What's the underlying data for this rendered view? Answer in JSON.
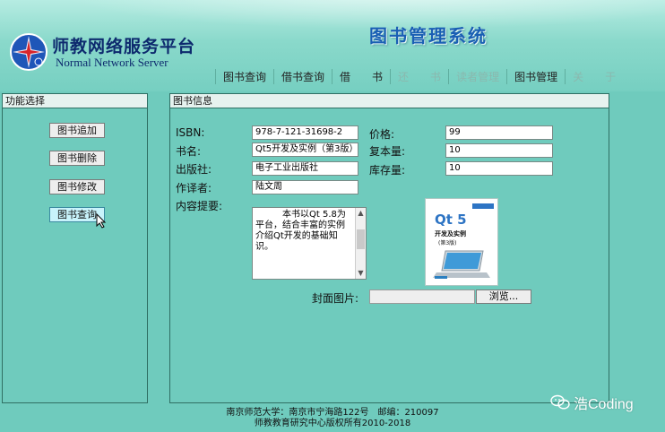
{
  "header": {
    "org_cn": "师教网络服务平台",
    "org_en": "Normal Network Server",
    "system_title": "图书管理系统",
    "nav": [
      {
        "label": "图书查询",
        "state": "normal"
      },
      {
        "label": "借书查询",
        "state": "normal"
      },
      {
        "label": "借　　书",
        "state": "normal"
      },
      {
        "label": "还　　书",
        "state": "dim"
      },
      {
        "label": "读者管理",
        "state": "dim"
      },
      {
        "label": "图书管理",
        "state": "normal"
      },
      {
        "label": "关　　于",
        "state": "dim"
      }
    ]
  },
  "left_panel": {
    "title": "功能选择",
    "buttons": [
      "图书追加",
      "图书删除",
      "图书修改",
      "图书查询"
    ],
    "active_index": 3
  },
  "book_info": {
    "title": "图书信息",
    "isbn_label": "ISBN:",
    "isbn": "978-7-121-31698-2",
    "name_label": "书名:",
    "name": "Qt5开发及实例（第3版）",
    "publisher_label": "出版社:",
    "publisher": "电子工业出版社",
    "author_label": "作译者:",
    "author": "陆文周",
    "summary_label": "内容提要:",
    "summary": "　　　本书以Qt 5.8为平台，结合丰富的实例介绍Qt开发的基础知识。",
    "price_label": "价格:",
    "price": "99",
    "copies_label": "复本量:",
    "copies": "10",
    "stock_label": "库存量:",
    "stock": "10",
    "cover_label": "封面图片:",
    "browse_label": "浏览...",
    "cover_title": "Qt 5",
    "cover_subtitle": "开发及实例",
    "cover_edition": "(第3版)"
  },
  "footer": {
    "line1": "南京师范大学：南京市宁海路122号　邮编：210097",
    "line2": "师教教育研究中心版权所有2010-2018"
  },
  "watermark": {
    "text": "浩Coding"
  }
}
